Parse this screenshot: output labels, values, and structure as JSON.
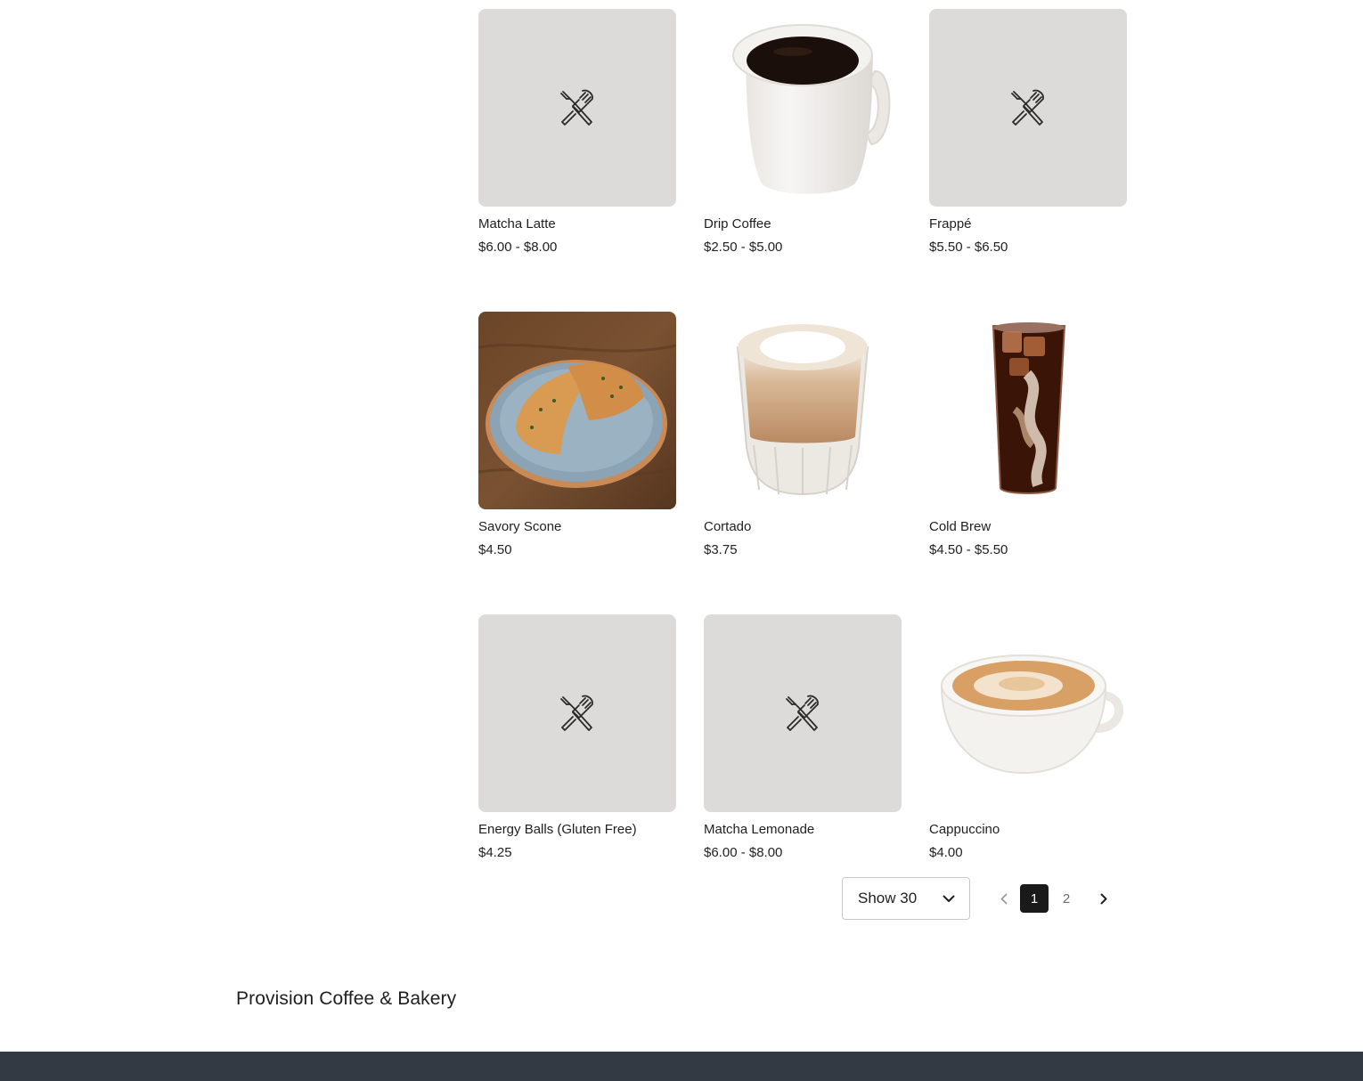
{
  "products": [
    {
      "name": "Matcha Latte",
      "price": "$6.00 - $8.00",
      "image": "placeholder-utensils-icon"
    },
    {
      "name": "Drip Coffee",
      "price": "$2.50 - $5.00",
      "image": "mug-photo"
    },
    {
      "name": "Frappé",
      "price": "$5.50 - $6.50",
      "image": "placeholder-utensils-icon"
    },
    {
      "name": "Savory Scone",
      "price": "$4.50",
      "image": "scone-photo"
    },
    {
      "name": "Cortado",
      "price": "$3.75",
      "image": "cortado-photo"
    },
    {
      "name": "Cold Brew",
      "price": "$4.50 - $5.50",
      "image": "cold-brew-photo"
    },
    {
      "name": "Energy Balls (Gluten Free)",
      "price": "$4.25",
      "image": "placeholder-utensils-icon"
    },
    {
      "name": "Matcha Lemonade",
      "price": "$6.00 - $8.00",
      "image": "placeholder-utensils-icon"
    },
    {
      "name": "Cappuccino",
      "price": "$4.00",
      "image": "cappuccino-photo"
    }
  ],
  "pagination": {
    "page_size_label": "Show 30",
    "pages": [
      "1",
      "2"
    ],
    "current_page": "1"
  },
  "footer": {
    "brand": "Provision Coffee & Bakery"
  },
  "colors": {
    "placeholder_bg": "#dddbda",
    "active_page_bg": "#1a1a1a",
    "footer_bar": "#333a44"
  }
}
